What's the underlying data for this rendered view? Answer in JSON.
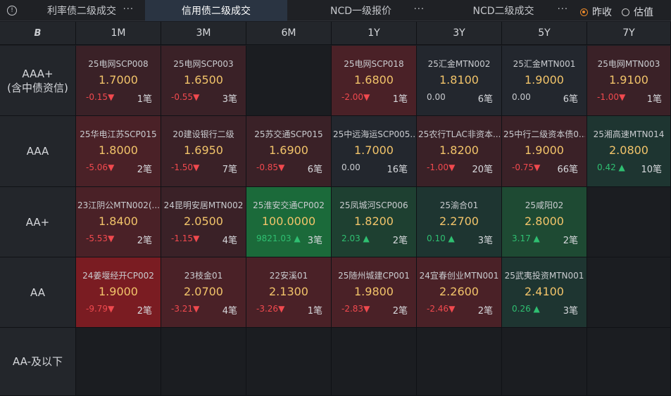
{
  "tabs": [
    {
      "label": "利率债二级成交",
      "active": false
    },
    {
      "label": "信用债二级成交",
      "active": true
    },
    {
      "label": "NCD一级报价",
      "active": false
    },
    {
      "label": "NCD二级成交",
      "active": false
    }
  ],
  "more_glyph": "···",
  "radio": [
    {
      "label": "昨收",
      "checked": true
    },
    {
      "label": "估值",
      "checked": false
    }
  ],
  "corner_label": "B",
  "columns": [
    "1M",
    "3M",
    "6M",
    "1Y",
    "3Y",
    "5Y",
    "7Y"
  ],
  "rows": [
    {
      "label": "AAA+",
      "sublabel": "(含中债资信)",
      "cells": [
        {
          "name": "25电网SCP008",
          "price": "1.7000",
          "change": "-0.15",
          "dir": "down",
          "count": "1笔",
          "bg": "#3a2127"
        },
        {
          "name": "25电网SCP003",
          "price": "1.6500",
          "change": "-0.55",
          "dir": "down",
          "count": "3笔",
          "bg": "#3a2127"
        },
        null,
        {
          "name": "25电网SCP018",
          "price": "1.6800",
          "change": "-2.00",
          "dir": "down",
          "count": "1笔",
          "bg": "#4a2127"
        },
        {
          "name": "25汇金MTN002",
          "price": "1.8100",
          "change": "0.00",
          "dir": "flat",
          "count": "6笔",
          "bg": "#23272e"
        },
        {
          "name": "25汇金MTN001",
          "price": "1.9000",
          "change": "0.00",
          "dir": "flat",
          "count": "6笔",
          "bg": "#23272e"
        },
        {
          "name": "25电网MTN003",
          "price": "1.9100",
          "change": "-1.00",
          "dir": "down",
          "count": "1笔",
          "bg": "#3a2127"
        }
      ]
    },
    {
      "label": "AAA",
      "sublabel": "",
      "cells": [
        {
          "name": "25华电江苏SCP015",
          "price": "1.8000",
          "change": "-5.06",
          "dir": "down",
          "count": "2笔",
          "bg": "#4a2127"
        },
        {
          "name": "20建设银行二级",
          "price": "1.6950",
          "change": "-1.50",
          "dir": "down",
          "count": "7笔",
          "bg": "#3a2127"
        },
        {
          "name": "25苏交通SCP015",
          "price": "1.6900",
          "change": "-0.85",
          "dir": "down",
          "count": "6笔",
          "bg": "#3a2127"
        },
        {
          "name": "25中远海运SCP005...",
          "price": "1.7000",
          "change": "0.00",
          "dir": "flat",
          "count": "16笔",
          "bg": "#23272e"
        },
        {
          "name": "25农行TLAC非资本...",
          "price": "1.8200",
          "change": "-1.00",
          "dir": "down",
          "count": "20笔",
          "bg": "#3a2127"
        },
        {
          "name": "25中行二级资本债0...",
          "price": "1.9000",
          "change": "-0.75",
          "dir": "down",
          "count": "66笔",
          "bg": "#3a2127"
        },
        {
          "name": "25湘高速MTN014",
          "price": "2.0800",
          "change": "0.42",
          "dir": "up",
          "count": "10笔",
          "bg": "#1e3531"
        }
      ]
    },
    {
      "label": "AA+",
      "sublabel": "",
      "cells": [
        {
          "name": "23江阴公MTN002(...",
          "price": "1.8400",
          "change": "-5.53",
          "dir": "down",
          "count": "2笔",
          "bg": "#4a2127"
        },
        {
          "name": "24昆明安居MTN002",
          "price": "2.0500",
          "change": "-1.15",
          "dir": "down",
          "count": "4笔",
          "bg": "#3a2127"
        },
        {
          "name": "25淮安交通CP002",
          "price": "100.0000",
          "change": "9821.03",
          "dir": "up",
          "count": "3笔",
          "bg": "#1b6a3a"
        },
        {
          "name": "25凤城河SCP006",
          "price": "1.8200",
          "change": "2.03",
          "dir": "up",
          "count": "2笔",
          "bg": "#1e4031"
        },
        {
          "name": "25渝合01",
          "price": "2.2700",
          "change": "0.10",
          "dir": "up",
          "count": "3笔",
          "bg": "#1e3531"
        },
        {
          "name": "25咸阳02",
          "price": "2.8000",
          "change": "3.17",
          "dir": "up",
          "count": "2笔",
          "bg": "#1e4a33"
        },
        null
      ]
    },
    {
      "label": "AA",
      "sublabel": "",
      "cells": [
        {
          "name": "24姜堰经开CP002",
          "price": "1.9000",
          "change": "-9.79",
          "dir": "down",
          "count": "2笔",
          "bg": "#7a1c22"
        },
        {
          "name": "23枝金01",
          "price": "2.0700",
          "change": "-3.21",
          "dir": "down",
          "count": "4笔",
          "bg": "#4a2127"
        },
        {
          "name": "22安溪01",
          "price": "2.1300",
          "change": "-3.26",
          "dir": "down",
          "count": "1笔",
          "bg": "#4a2127"
        },
        {
          "name": "25随州城建CP001",
          "price": "1.9800",
          "change": "-2.83",
          "dir": "down",
          "count": "2笔",
          "bg": "#4a2127"
        },
        {
          "name": "24宜春创业MTN001",
          "price": "2.2600",
          "change": "-2.46",
          "dir": "down",
          "count": "2笔",
          "bg": "#4a2127"
        },
        {
          "name": "25武夷投资MTN001",
          "price": "2.4100",
          "change": "0.26",
          "dir": "up",
          "count": "3笔",
          "bg": "#1e3531"
        },
        null
      ]
    },
    {
      "label": "AA-及以下",
      "sublabel": "",
      "cells": [
        null,
        null,
        null,
        null,
        null,
        null,
        null
      ]
    }
  ],
  "colors": {
    "up": "#2fbf71",
    "down": "#f0494e",
    "accent": "#e8882a",
    "empty_cell": "#1b1d21"
  }
}
